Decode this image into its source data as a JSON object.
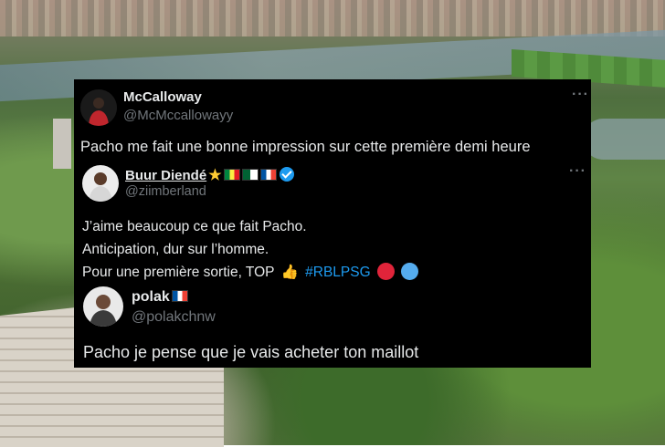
{
  "colors": {
    "card_bg": "#000000",
    "text_primary": "#e7e9ea",
    "text_secondary": "#71767b",
    "link": "#1d9bf0",
    "verified": "#1d9bf0"
  },
  "tweets": [
    {
      "display_name": "McCalloway",
      "handle": "@McMccallowayy",
      "text": "Pacho me fait une bonne impression sur cette première demi heure",
      "more_icon": "more-icon"
    },
    {
      "display_name": "Buur Diendé",
      "name_decorations": [
        "star-emoji",
        "senegal-flag",
        "algeria-flag",
        "france-flag",
        "verified-badge"
      ],
      "handle": "@ziimberland",
      "lines": [
        "J’aime beaucoup ce que fait Pacho.",
        "Anticipation, dur sur l’homme.",
        "Pour une première sortie, TOP"
      ],
      "hashtag": "#RBLPSG",
      "line_emojis": [
        "thumbs-up-emoji",
        "red-circle-emoji",
        "blue-circle-emoji"
      ],
      "more_icon": "more-icon"
    },
    {
      "display_name": "polak",
      "name_decorations": [
        "france-flag"
      ],
      "handle": "@polakchnw",
      "text": "Pacho je pense que je vais acheter ton maillot"
    }
  ]
}
